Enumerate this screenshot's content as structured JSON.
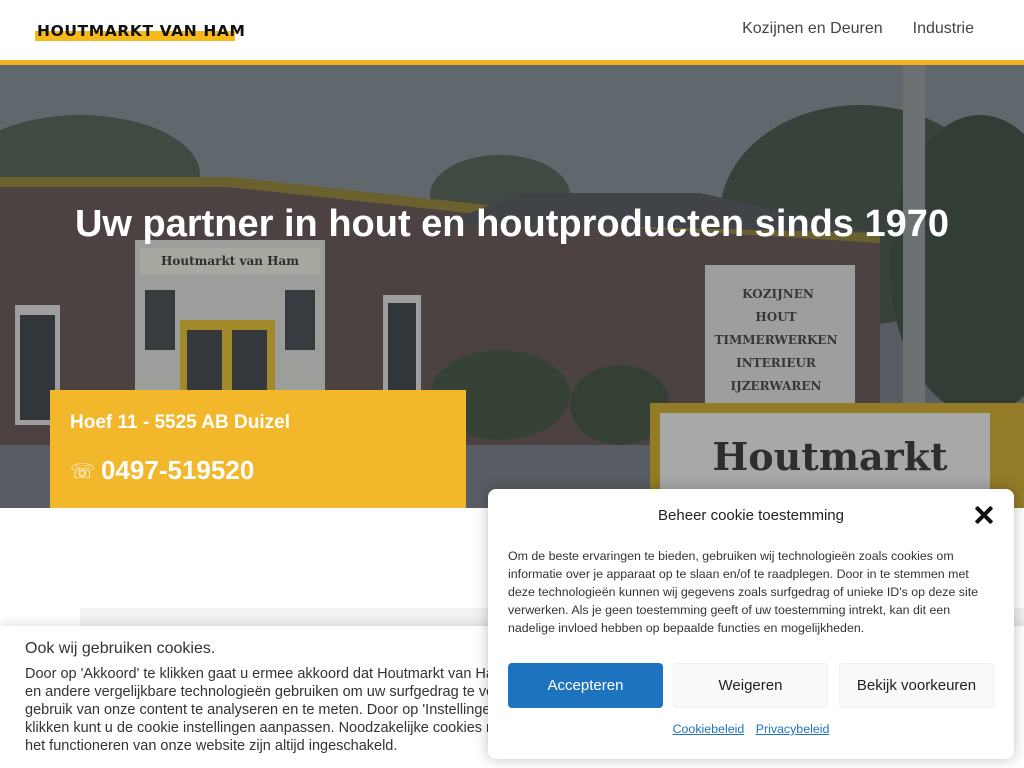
{
  "header": {
    "logo_text": "HOUTMARKT VAN HAM",
    "nav": [
      {
        "label": "Kozijnen en Deuren"
      },
      {
        "label": "Industrie"
      }
    ]
  },
  "hero": {
    "title": "Uw partner in hout en houtproducten sinds 1970",
    "sign_top": "Houtmarkt van Ham",
    "sign_list": [
      "KOZIJNEN",
      "HOUT",
      "TIMMERWERKEN",
      "INTERIEUR",
      "IJZERWAREN"
    ],
    "sign_board": "Houtmarkt"
  },
  "contact": {
    "address": "Hoef 11 - 5525 AB Duizel",
    "phone_icon": "☏",
    "phone": "0497-519520"
  },
  "cookie_bar": {
    "title": "Ook wij gebruiken cookies.",
    "text": "Door op 'Akkoord' te klikken gaat u ermee akkoord dat Houtmarkt van Ham cookies en andere vergelijkbare technologieën gebruiken om uw surfgedrag te volgen en gebruik van onze content te analyseren en te meten. Door op 'Instellingen' te klikken kunt u de cookie instellingen aanpassen. Noodzakelijke cookies nodig voor het functioneren van onze website zijn altijd ingeschakeld."
  },
  "modal": {
    "title": "Beheer cookie toestemming",
    "close_icon": "close-icon",
    "text": "Om de beste ervaringen te bieden, gebruiken wij technologieën zoals cookies om informatie over je apparaat op te slaan en/of te raadplegen. Door in te stemmen met deze technologieën kunnen wij gegevens zoals surfgedrag of unieke ID's op deze site verwerken. Als je geen toestemming geeft of uw toestemming intrekt, kan dit een nadelige invloed hebben op bepaalde functies en mogelijkheden.",
    "accept_label": "Accepteren",
    "decline_label": "Weigeren",
    "prefs_label": "Bekijk voorkeuren",
    "link_cookie": "Cookiebeleid",
    "link_privacy": "Privacybeleid"
  },
  "colors": {
    "brand_yellow": "#f2b72a",
    "accent_blue": "#1e73be"
  }
}
